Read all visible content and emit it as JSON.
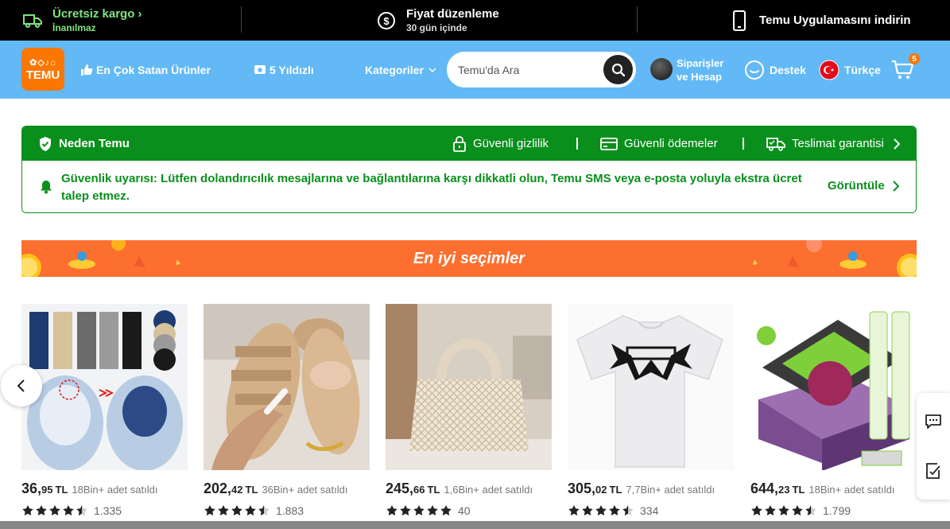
{
  "promo": {
    "shipping_title": "Ücretsiz kargo",
    "shipping_sub": "İnanılmaz",
    "price_title": "Fiyat düzenleme",
    "price_sub": "30 gün içinde",
    "app_title": "Temu Uygulamasını indirin"
  },
  "header": {
    "logo_text": "TEMU",
    "bestsellers": "En Çok Satan Ürünler",
    "five_star": "5 Yıldızlı",
    "categories": "Kategoriler",
    "search_placeholder": "Temu'da Ara",
    "account_line1": "Siparişler",
    "account_line2": "ve Hesap",
    "support": "Destek",
    "language": "Türkçe",
    "cart_count": "5"
  },
  "trust": {
    "why_temu": "Neden Temu",
    "privacy": "Güvenli gizlilik",
    "payments": "Güvenli ödemeler",
    "delivery": "Teslimat garantisi",
    "alert": "Güvenlik uyarısı: Lütfen dolandırıcılık mesajlarına ve bağlantılarına karşı dikkatli olun, Temu SMS veya e-posta yoluyla ekstra ücret talep etmez.",
    "view": "Görüntüle"
  },
  "banner": {
    "title": "En iyi seçimler"
  },
  "products": [
    {
      "price_int": "36,",
      "price_dec": "95",
      "currency": "TL",
      "sold": "18Bin+ adet satıldı",
      "rating": 4.5,
      "reviews": "1.335"
    },
    {
      "price_int": "202,",
      "price_dec": "42",
      "currency": "TL",
      "sold": "36Bin+ adet satıldı",
      "rating": 4.5,
      "reviews": "1.883"
    },
    {
      "price_int": "245,",
      "price_dec": "66",
      "currency": "TL",
      "sold": "1,6Bin+ adet satıldı",
      "rating": 5,
      "reviews": "40"
    },
    {
      "price_int": "305,",
      "price_dec": "02",
      "currency": "TL",
      "sold": "7,7Bin+ adet satıldı",
      "rating": 4.5,
      "reviews": "334"
    },
    {
      "price_int": "644,",
      "price_dec": "23",
      "currency": "TL",
      "sold": "18Bin+ adet satıldı",
      "rating": 4.5,
      "reviews": "1.799"
    }
  ],
  "colors": {
    "header_bg": "#62b9f5",
    "brand_orange": "#fb7701",
    "trust_green": "#0a8f1d",
    "banner_orange": "#fc6f2f"
  }
}
